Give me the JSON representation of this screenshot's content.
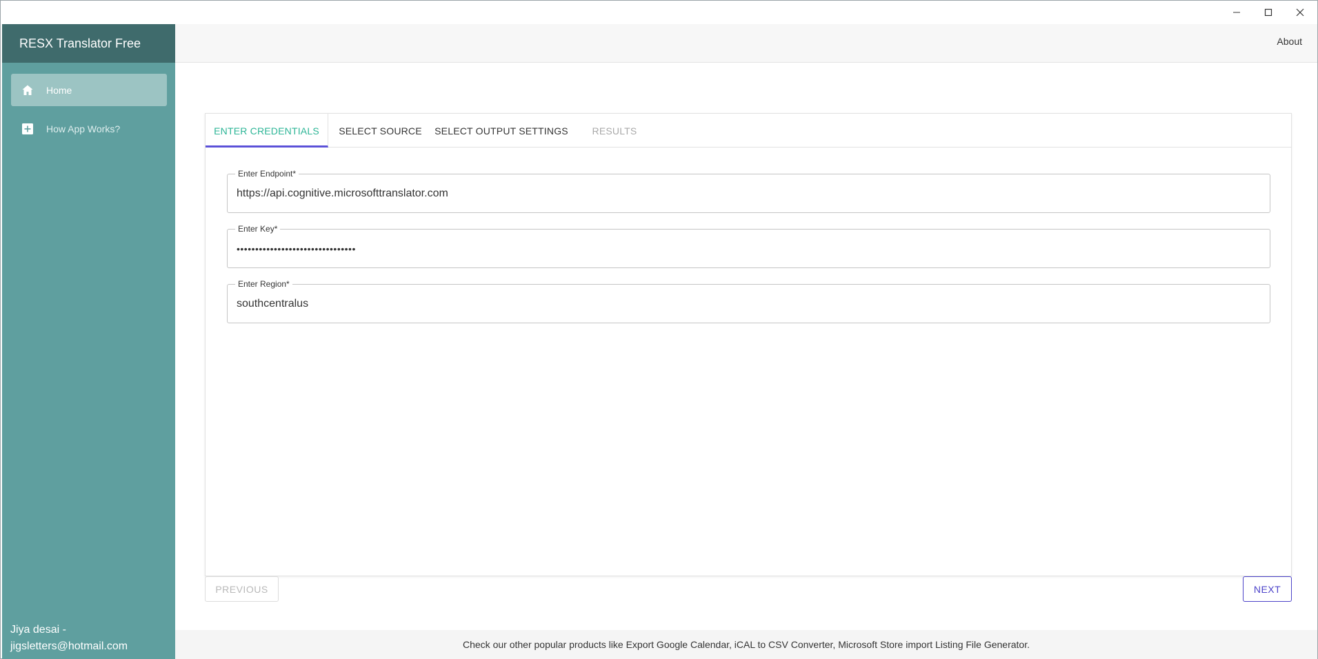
{
  "window": {
    "minimize_label": "Minimize",
    "maximize_label": "Maximize",
    "close_label": "Close"
  },
  "sidebar": {
    "app_title": "RESX Translator Free",
    "items": [
      {
        "label": "Home",
        "icon": "home-icon",
        "active": true
      },
      {
        "label": "How App Works?",
        "icon": "plus-box-icon",
        "active": false
      }
    ],
    "user_name": "Jiya desai -",
    "user_email": "jigsletters@hotmail.com"
  },
  "appbar": {
    "about_label": "About"
  },
  "tabs": [
    {
      "label": "ENTER CREDENTIALS",
      "state": "active"
    },
    {
      "label": "SELECT SOURCE",
      "state": "enabled"
    },
    {
      "label": "SELECT OUTPUT SETTINGS",
      "state": "enabled"
    },
    {
      "label": "RESULTS",
      "state": "disabled"
    }
  ],
  "form": {
    "endpoint": {
      "label": "Enter Endpoint*",
      "value": "https://api.cognitive.microsofttranslator.com"
    },
    "key": {
      "label": "Enter Key*",
      "value": "••••••••••••••••••••••••••••••••"
    },
    "region": {
      "label": "Enter Region*",
      "value": "southcentralus"
    }
  },
  "buttons": {
    "previous_label": "PREVIOUS",
    "next_label": "NEXT"
  },
  "footer": {
    "text": "Check our other popular products like Export Google Calendar, iCAL to CSV Converter, Microsoft Store import Listing File Generator."
  },
  "colors": {
    "sidebar_bg": "#5f9f9f",
    "sidebar_header_bg": "#3f6b6c",
    "active_nav_bg": "#9cc4c3",
    "active_tab_text": "#2cb596",
    "active_tab_underline": "#5b51d8",
    "next_button": "#4b42c9"
  }
}
